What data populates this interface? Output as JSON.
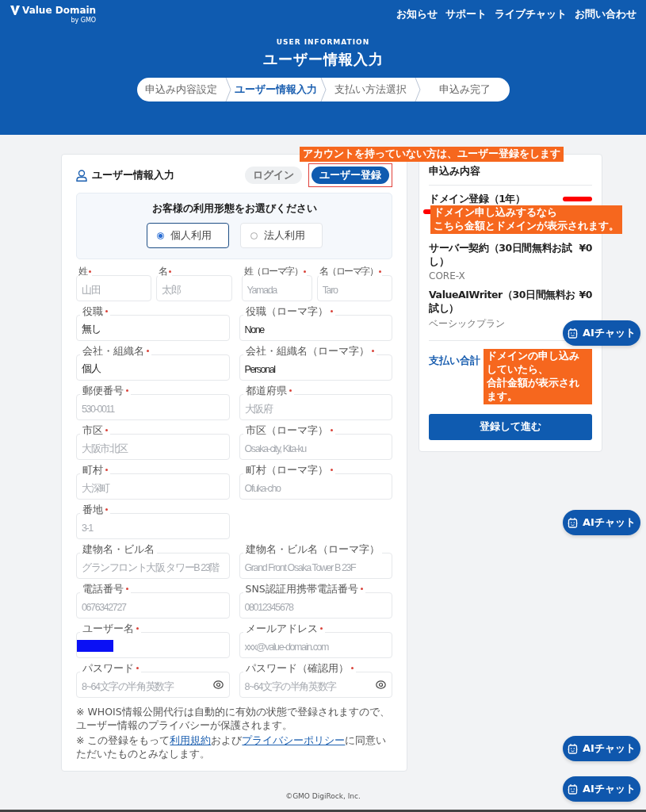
{
  "header": {
    "logo": "Value Domain",
    "logo_sub": "by GMO",
    "nav": [
      "お知らせ",
      "サポート",
      "ライブチャット",
      "お問い合わせ"
    ],
    "eyebrow": "USER INFORMATION",
    "title": "ユーザー情報入力",
    "steps": [
      {
        "label": "申込み内容設定",
        "selected": false
      },
      {
        "label": "ユーザー情報入力",
        "selected": true
      },
      {
        "label": "支払い方法選択",
        "selected": false
      },
      {
        "label": "申込み完了",
        "selected": false
      }
    ]
  },
  "form": {
    "title": "ユーザー情報入力",
    "auth_buttons": [
      {
        "label": "ログイン",
        "selected": false,
        "highlighted": false
      },
      {
        "label": "ユーザー登録",
        "selected": true,
        "highlighted": true
      }
    ],
    "auth_note": "アカウントを持っていない方は、ユーザー登録をします",
    "usage": {
      "prompt": "お客様の利用形態をお選びください",
      "options": [
        {
          "label": "個人利用",
          "selected": true
        },
        {
          "label": "法人利用",
          "selected": false
        }
      ]
    },
    "rows": [
      {
        "kind": "quad",
        "fields": [
          {
            "label": "姓",
            "required": true,
            "placeholder": "山田"
          },
          {
            "label": "名",
            "required": true,
            "placeholder": "太郎"
          },
          {
            "label": "姓（ローマ字）",
            "required": true,
            "placeholder": "Yamada"
          },
          {
            "label": "名（ローマ字）",
            "required": true,
            "placeholder": "Taro"
          }
        ]
      },
      {
        "kind": "pair",
        "fields": [
          {
            "label": "役職",
            "required": true,
            "value": "無し"
          },
          {
            "label": "役職（ローマ字）",
            "required": true,
            "value": "None"
          }
        ]
      },
      {
        "kind": "pair",
        "fields": [
          {
            "label": "会社・組織名",
            "required": true,
            "value": "個人"
          },
          {
            "label": "会社・組織名（ローマ字）",
            "required": true,
            "value": "Personal"
          }
        ]
      },
      {
        "kind": "pair",
        "fields": [
          {
            "label": "郵便番号",
            "required": true,
            "placeholder": "530-0011"
          },
          {
            "label": "都道府県",
            "required": true,
            "placeholder": "大阪府"
          }
        ]
      },
      {
        "kind": "pair",
        "fields": [
          {
            "label": "市区",
            "required": true,
            "placeholder": "大阪市北区"
          },
          {
            "label": "市区（ローマ字）",
            "required": true,
            "placeholder": "Osaka-city, Kita-ku"
          }
        ]
      },
      {
        "kind": "pair",
        "fields": [
          {
            "label": "町村",
            "required": true,
            "placeholder": "大深町"
          },
          {
            "label": "町村（ローマ字）",
            "required": true,
            "placeholder": "Ofuka-cho"
          }
        ]
      },
      {
        "kind": "pair",
        "fields": [
          {
            "label": "番地",
            "required": true,
            "placeholder": "3-1"
          }
        ]
      },
      {
        "kind": "pair",
        "fields": [
          {
            "label": "建物名・ビル名",
            "required": false,
            "placeholder": "グランフロント大阪 タワーB 23階"
          },
          {
            "label": "建物名・ビル名（ローマ字）",
            "required": false,
            "placeholder": "Grand Front Osaka Tower B 23F"
          }
        ]
      },
      {
        "kind": "pair",
        "fields": [
          {
            "label": "電話番号",
            "required": true,
            "placeholder": "0676342727"
          },
          {
            "label": "SNS認証用携帯電話番号",
            "required": true,
            "placeholder": "08012345678"
          }
        ]
      },
      {
        "kind": "pair",
        "fields": [
          {
            "label": "ユーザー名",
            "required": true,
            "kind": "redacted"
          },
          {
            "label": "メールアドレス",
            "required": true,
            "placeholder": "xxx@value-domain.com"
          }
        ]
      },
      {
        "kind": "pair",
        "fields": [
          {
            "label": "パスワード",
            "required": true,
            "kind": "password",
            "placeholder": "8~64文字の半角英数字"
          },
          {
            "label": "パスワード（確認用）",
            "required": true,
            "kind": "password",
            "placeholder": "8~64文字の半角英数字"
          }
        ]
      }
    ],
    "notes": [
      [
        {
          "kind": "text",
          "text": "※ WHOIS情報公開代行は自動的に有効の状態で登録されますので、ユーザー情報のプライバシーが保護されます。"
        }
      ],
      [
        {
          "kind": "text",
          "text": "※ この登録をもって"
        },
        {
          "kind": "link",
          "text": "利用規約"
        },
        {
          "kind": "text",
          "text": "および"
        },
        {
          "kind": "link",
          "text": "プライバシーポリシー"
        },
        {
          "kind": "text",
          "text": "に同意いただいたものとみなします。"
        }
      ]
    ]
  },
  "summary": {
    "title": "申込み内容",
    "items": [
      {
        "name": "ドメイン登録（1年）",
        "redacted": true,
        "note": [
          "ドメイン申し込みするなら",
          "こちら金額とドメインが表示されます。"
        ]
      },
      {
        "name": "サーバー契約（30日間無料お試し）",
        "price": "¥0",
        "sub": "CORE-X"
      },
      {
        "name": "ValueAIWriter（30日間無料お試し）",
        "price": "¥0",
        "sub": "ベーシックプラン"
      }
    ],
    "total_label": "支払い合計",
    "total_note": [
      "ドメインの申し込みしていたら、",
      "合計金額が表示されます。"
    ],
    "button": "登録して進む"
  },
  "chat_buttons": [
    "AIチャット",
    "AIチャット",
    "AIチャット",
    "AIチャット"
  ],
  "footer": "©GMO DigiRock, Inc."
}
